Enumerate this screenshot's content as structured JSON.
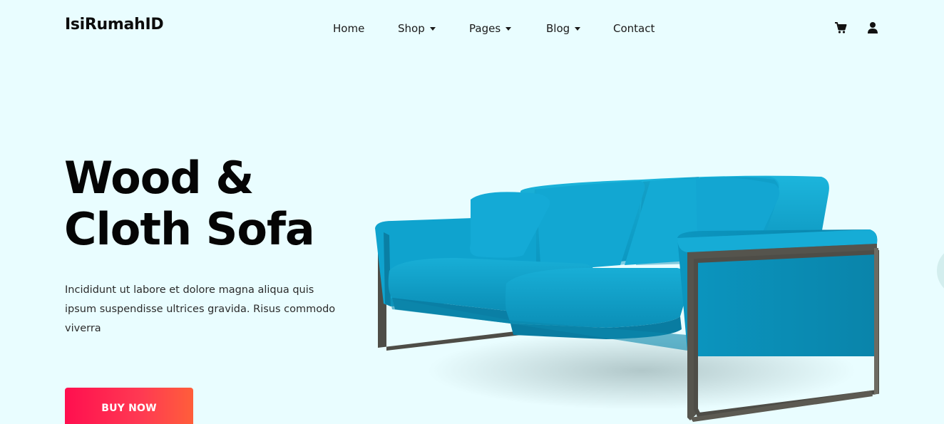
{
  "brand": {
    "name": "IsiRumahID"
  },
  "nav": {
    "items": [
      {
        "label": "Home",
        "dropdown": false
      },
      {
        "label": "Shop",
        "dropdown": true
      },
      {
        "label": "Pages",
        "dropdown": true
      },
      {
        "label": "Blog",
        "dropdown": true
      },
      {
        "label": "Contact",
        "dropdown": false
      }
    ]
  },
  "header_icons": {
    "cart": "cart-icon",
    "user": "user-icon"
  },
  "hero": {
    "title_line1": "Wood &",
    "title_line2": "Cloth Sofa",
    "description": "Incididunt ut labore et dolore magna aliqua quis ipsum suspendisse ultrices gravida. Risus commodo viverra",
    "cta_label": "BUY NOW"
  },
  "colors": {
    "background": "#e9fdff",
    "cta_gradient_start": "#ff0f4f",
    "cta_gradient_end": "#ff5e3a",
    "sofa_fabric": "#0ea3cc",
    "sofa_frame": "#4a4a44"
  }
}
